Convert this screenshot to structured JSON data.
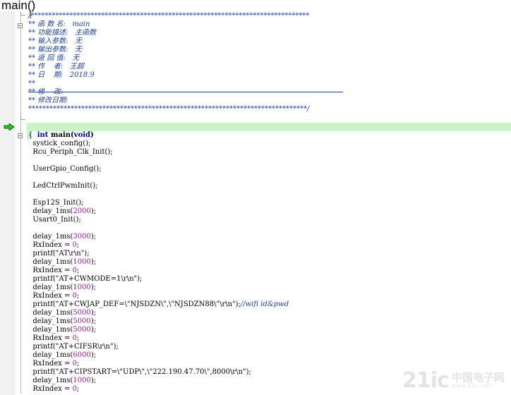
{
  "window": {
    "title": "main()"
  },
  "editor": {
    "comment_header": [
      "/*******************************************************************************",
      "** 函 数 名:   main",
      "** 功能描述:   主函数",
      "** 输入参数:   无",
      "** 输出参数:   无",
      "** 返 回 值:   无",
      "** 作    者:   王超",
      "** 日    期:   2018.9",
      "**",
      "** 修    改:",
      "** 修改日期:",
      "*******************************************************************************/"
    ],
    "function_signature": {
      "keyword": "int",
      "name": " main(",
      "param": "void",
      "close": ")"
    },
    "open_brace": "{",
    "closing_brace_prev": "}",
    "code_lines": [
      {
        "text": "  systick_config();"
      },
      {
        "text": "  Rcu_Periph_Clk_Init();"
      },
      {
        "text": ""
      },
      {
        "text": "  UserGpio_Config();"
      },
      {
        "text": ""
      },
      {
        "text": "  LedCtrlPwmInit();"
      },
      {
        "text": ""
      },
      {
        "text": "  Esp12S_Init();"
      },
      {
        "text": "  delay_1ms(",
        "num": "2000",
        "tail": ");"
      },
      {
        "text": "  Usart0_Init();"
      },
      {
        "text": ""
      },
      {
        "text": "  delay_1ms(",
        "num": "3000",
        "tail": ");"
      },
      {
        "text": "  RxIndex = ",
        "num": "0",
        "tail": ";"
      },
      {
        "text": "  printf(\"AT\\r\\n\");"
      },
      {
        "text": "  delay_1ms(",
        "num": "1000",
        "tail": ");"
      },
      {
        "text": "  RxIndex = ",
        "num": "0",
        "tail": ";"
      },
      {
        "text": "  printf(\"AT+CWMODE=1\\r\\n\");"
      },
      {
        "text": "  delay_1ms(",
        "num": "1000",
        "tail": ");"
      },
      {
        "text": "  RxIndex = ",
        "num": "0",
        "tail": ";"
      },
      {
        "text": "  printf(\"AT+CWJAP_DEF=\\\"NJSDZN\\\",\\\"NJSDZN88\\\"\\r\\n\");",
        "comment": "//wifi id&pwd"
      },
      {
        "text": "  delay_1ms(",
        "num": "5000",
        "tail": ");"
      },
      {
        "text": "  delay_1ms(",
        "num": "5000",
        "tail": ");"
      },
      {
        "text": "  delay_1ms(",
        "num": "5000",
        "tail": ");"
      },
      {
        "text": "  RxIndex = ",
        "num": "0",
        "tail": ";"
      },
      {
        "text": "  printf(\"AT+CIFSR\\r\\n\");"
      },
      {
        "text": "  delay_1ms(",
        "num": "6000",
        "tail": ");"
      },
      {
        "text": "  RxIndex = ",
        "num": "0",
        "tail": ";"
      },
      {
        "text": "  printf(\"AT+CIPSTART=\\\"UDP\\\",\\\"222.190.47.70\\\",8000\\r\\n\");"
      },
      {
        "text": "  delay_1ms(",
        "num": "1000",
        "tail": ");"
      },
      {
        "text": "  RxIndex = ",
        "num": "0",
        "tail": ";"
      }
    ],
    "current_line_icon": "execution-arrow-icon",
    "current_line_color": "#c9f3c9"
  },
  "watermark": {
    "logo": "21ic",
    "name": "中国电子网",
    "url": "www.21ic.com"
  }
}
